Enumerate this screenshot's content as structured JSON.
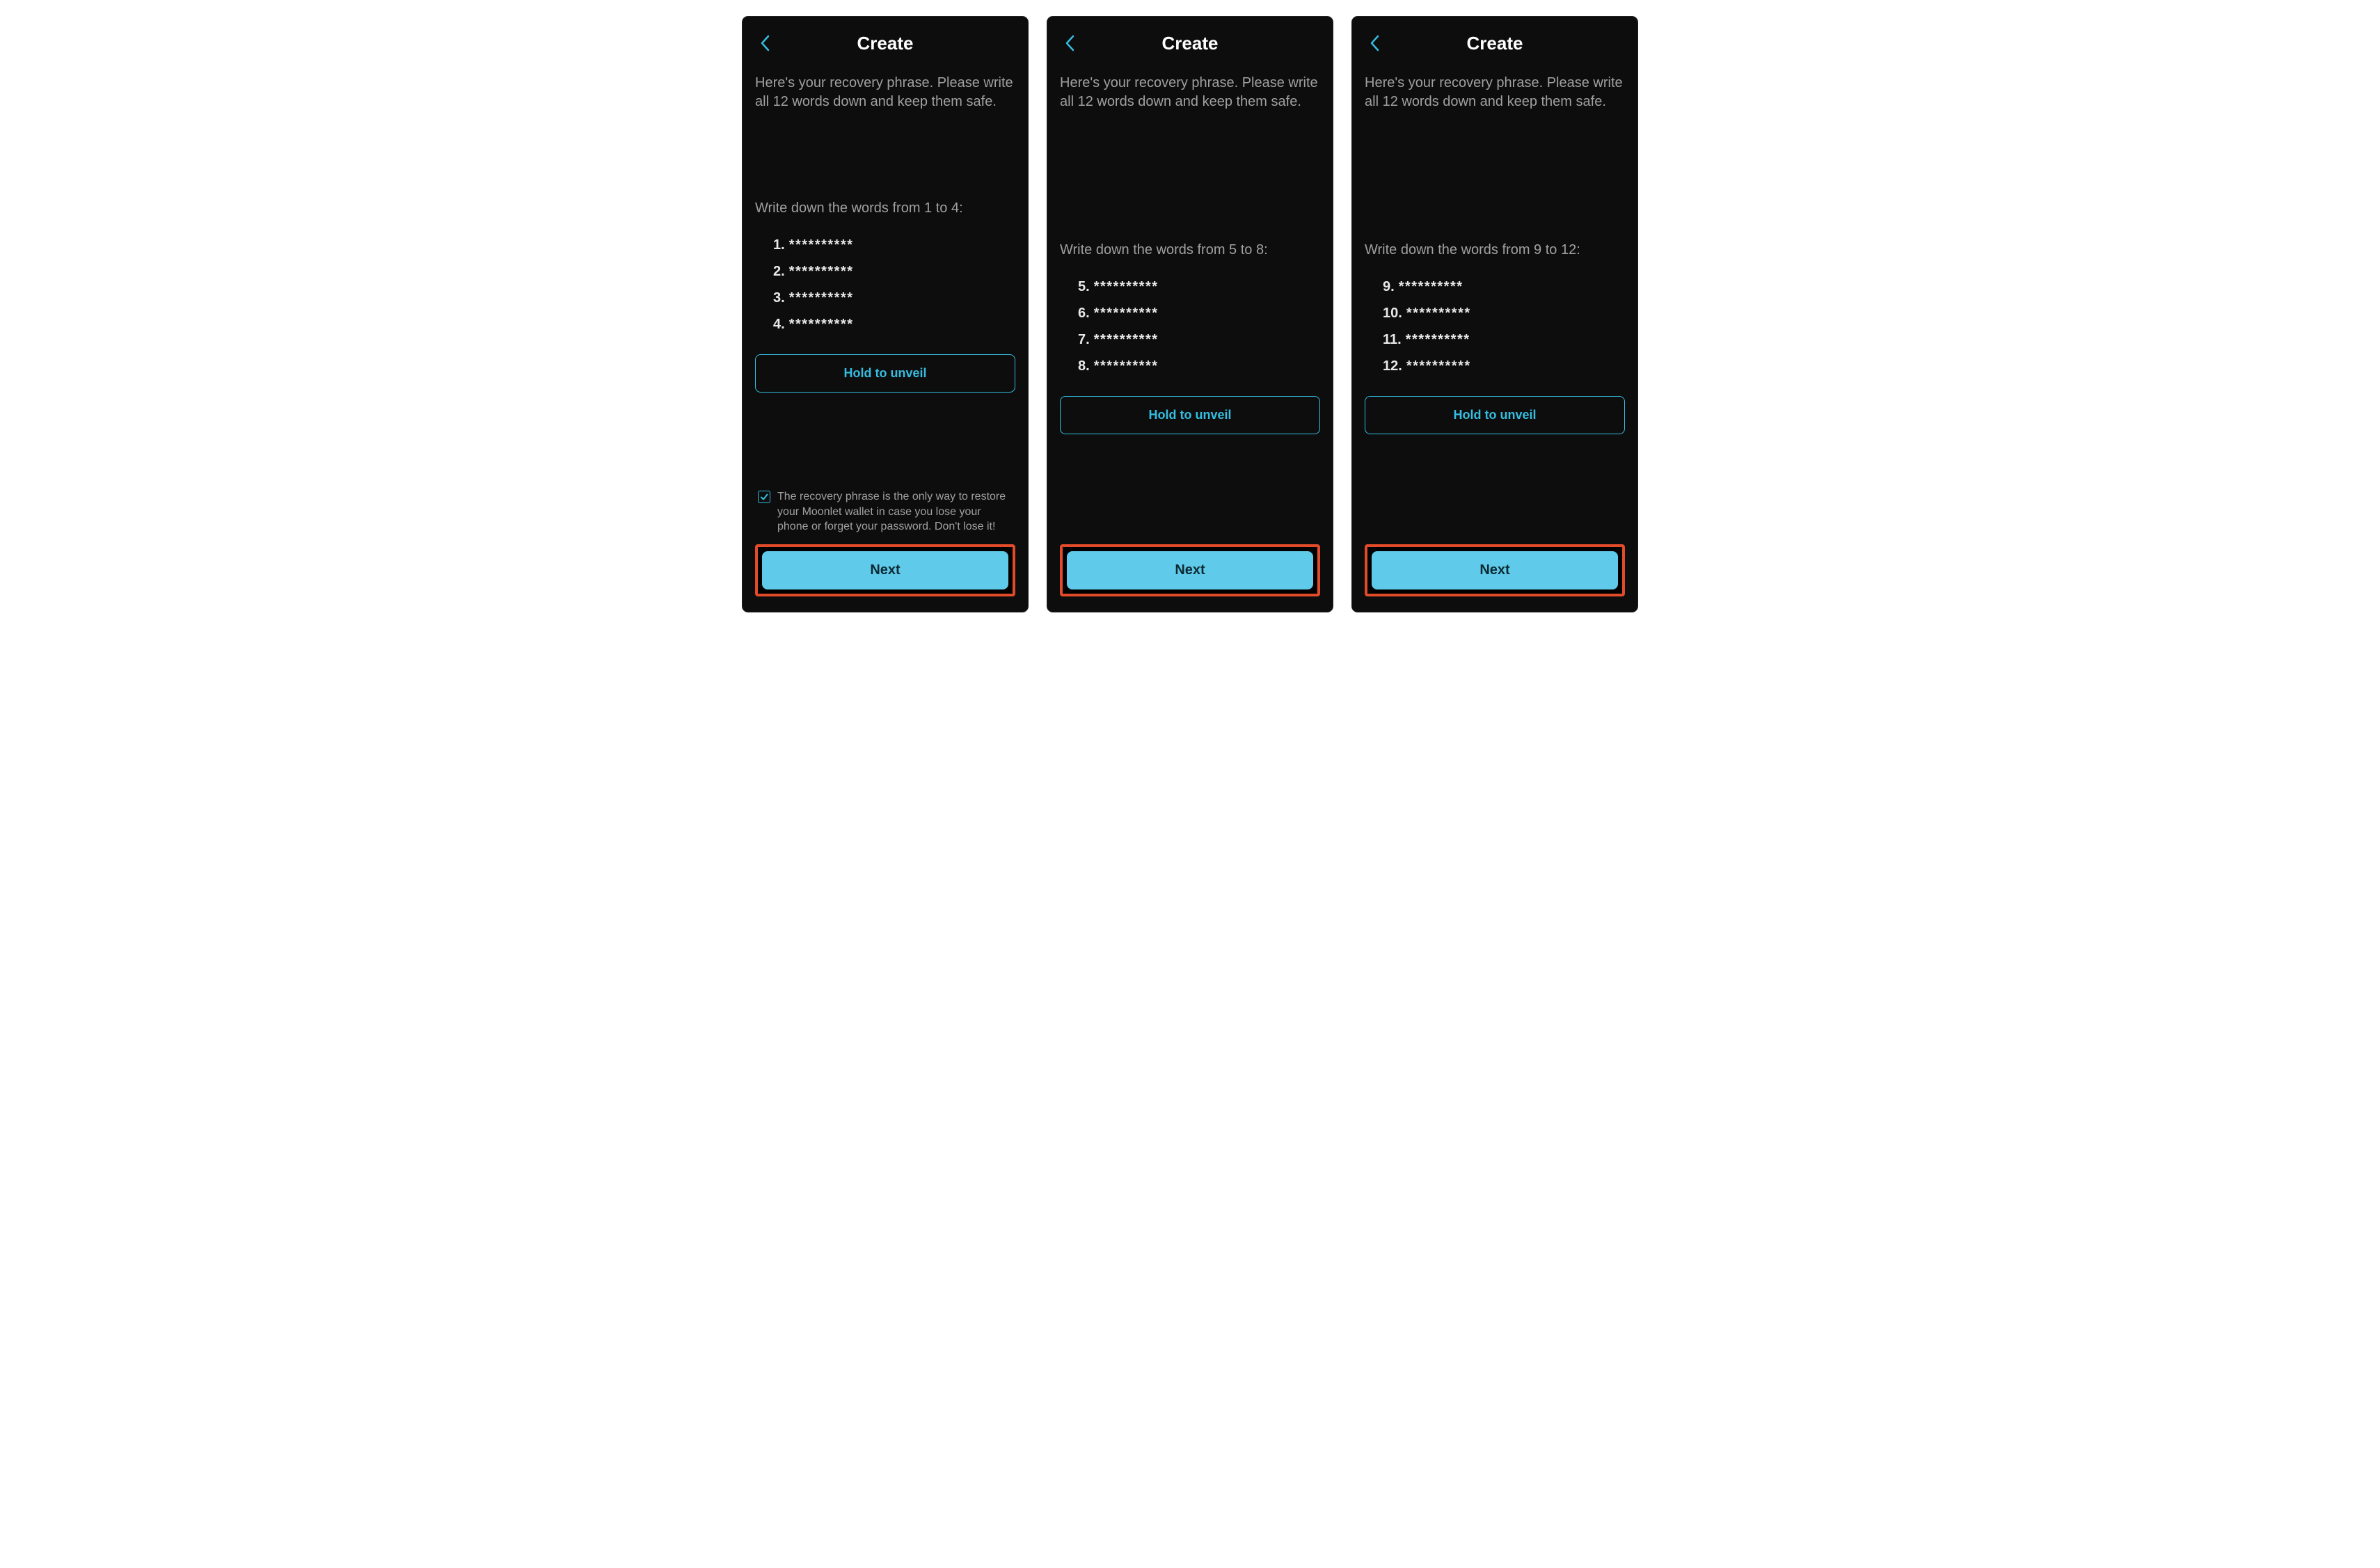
{
  "colors": {
    "accent": "#35bde0",
    "highlight_border": "#e14b29",
    "background": "#0d0d0d"
  },
  "common": {
    "title": "Create",
    "instructions": "Here's your recovery phrase. Please write all 12 words down and keep them safe.",
    "unveil_label": "Hold to unveil",
    "next_label": "Next",
    "mask": "**********"
  },
  "screens": [
    {
      "subtitle": "Write down the words from 1 to 4:",
      "word_nums": [
        "1.",
        "2.",
        "3.",
        "4."
      ],
      "show_checkbox": true,
      "checkbox_label": "The recovery phrase is the only way to restore your Moonlet wallet in case you lose your phone or forget your password. Don't lose it!",
      "gap_class": "gap-mid-0"
    },
    {
      "subtitle": "Write down the words from 5 to 8:",
      "word_nums": [
        "5.",
        "6.",
        "7.",
        "8."
      ],
      "show_checkbox": false,
      "checkbox_label": "",
      "gap_class": "gap-mid-12"
    },
    {
      "subtitle": "Write down the words from 9 to 12:",
      "word_nums": [
        "9.",
        "10.",
        "11.",
        "12."
      ],
      "show_checkbox": false,
      "checkbox_label": "",
      "gap_class": "gap-mid-12"
    }
  ]
}
